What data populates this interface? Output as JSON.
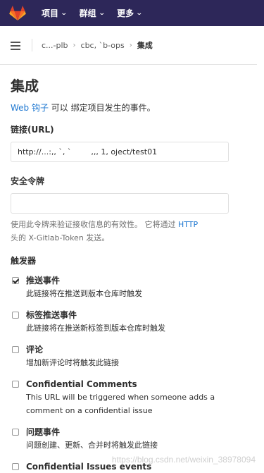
{
  "colors": {
    "topbar": "#2d2759",
    "link": "#1f78d1",
    "logo": "#e24329"
  },
  "topnav": {
    "items": [
      {
        "label": "项目"
      },
      {
        "label": "群组"
      },
      {
        "label": "更多"
      }
    ]
  },
  "breadcrumb": {
    "items": [
      "c...-plb",
      "cbc, `b-ops",
      "集成"
    ]
  },
  "page": {
    "title": "集成",
    "intro_link": "Web 钩子",
    "intro_rest": " 可以 绑定项目发生的事件。"
  },
  "form": {
    "url_label": "链接(URL)",
    "url_value": "http://...:,, `, `        ,,, 1, oject/test01",
    "token_label": "安全令牌",
    "token_value": "",
    "help_text_a": "使用此令牌来验证接收信息的有效性。 它将通过 ",
    "help_text_http": "HTTP",
    "help_text_b": "头的 X-Gitlab-Token 发送。",
    "triggers_label": "触发器"
  },
  "triggers": [
    {
      "title": "推送事件",
      "desc": "此链接将在推送到版本仓库时触发",
      "checked": true
    },
    {
      "title": "标签推送事件",
      "desc": "此链接将在推送新标签到版本仓库时触发",
      "checked": false
    },
    {
      "title": "评论",
      "desc": "增加新评论时将触发此链接",
      "checked": false
    },
    {
      "title": "Confidential Comments",
      "desc": "This URL will be triggered when someone adds a comment on a confidential issue",
      "checked": false
    },
    {
      "title": "问题事件",
      "desc": "问题创建、更新、合并时将触发此链接",
      "checked": false
    },
    {
      "title": "Confidential Issues events",
      "desc": "",
      "checked": false
    }
  ],
  "watermark": "https://blog.csdn.net/weixin_38978094"
}
